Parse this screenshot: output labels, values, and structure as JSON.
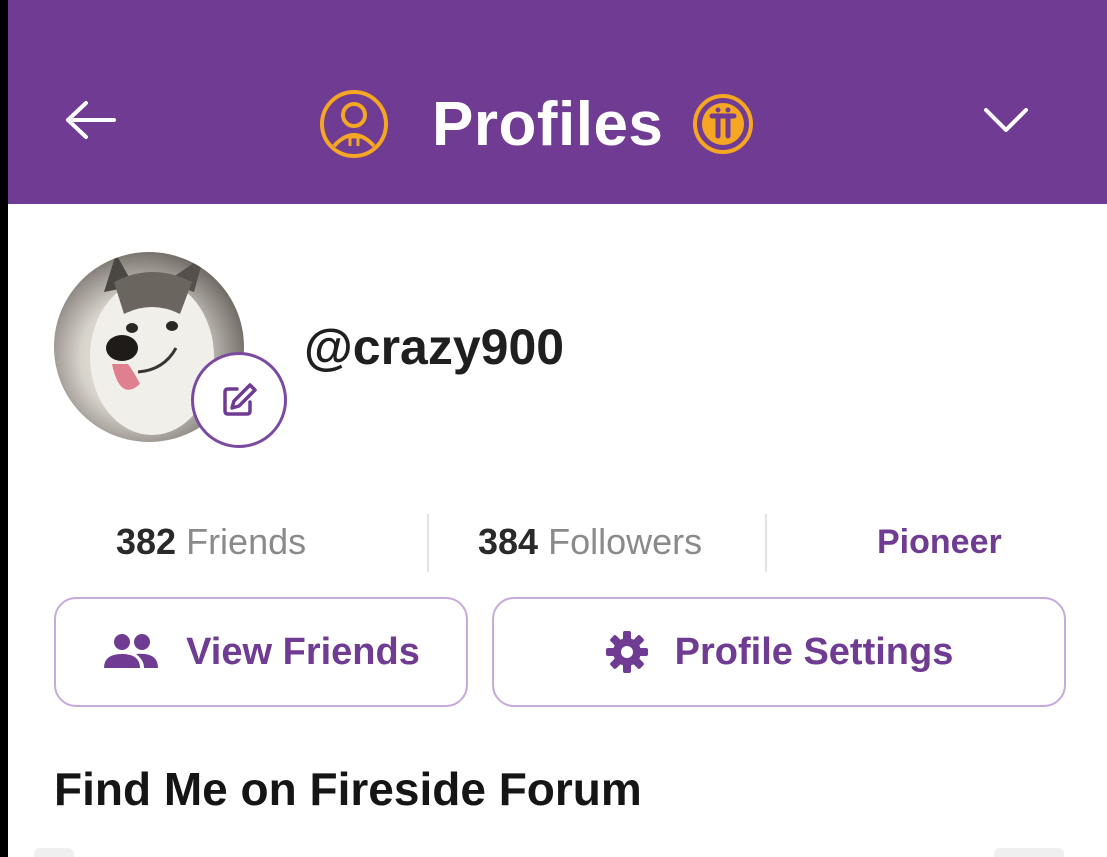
{
  "header": {
    "title": "Profiles",
    "back_icon": "arrow-left-icon",
    "profile_icon": "pi-profile-circle-icon",
    "pi_icon": "pi-coin-icon",
    "dropdown_icon": "chevron-down-icon",
    "colors": {
      "bar": "#6f3b93",
      "accent": "#f5a623",
      "text": "#ffffff"
    }
  },
  "profile": {
    "username": "@crazy900",
    "avatar_icon": "avatar-husky-photo",
    "edit_icon": "edit-pencil-icon"
  },
  "stats": {
    "friends_count": "382",
    "friends_label": "Friends",
    "followers_count": "384",
    "followers_label": "Followers",
    "role": "Pioneer"
  },
  "actions": {
    "view_friends_label": "View Friends",
    "view_friends_icon": "people-icon",
    "profile_settings_label": "Profile Settings",
    "profile_settings_icon": "gear-icon"
  },
  "section": {
    "title": "Find Me on Fireside Forum"
  }
}
